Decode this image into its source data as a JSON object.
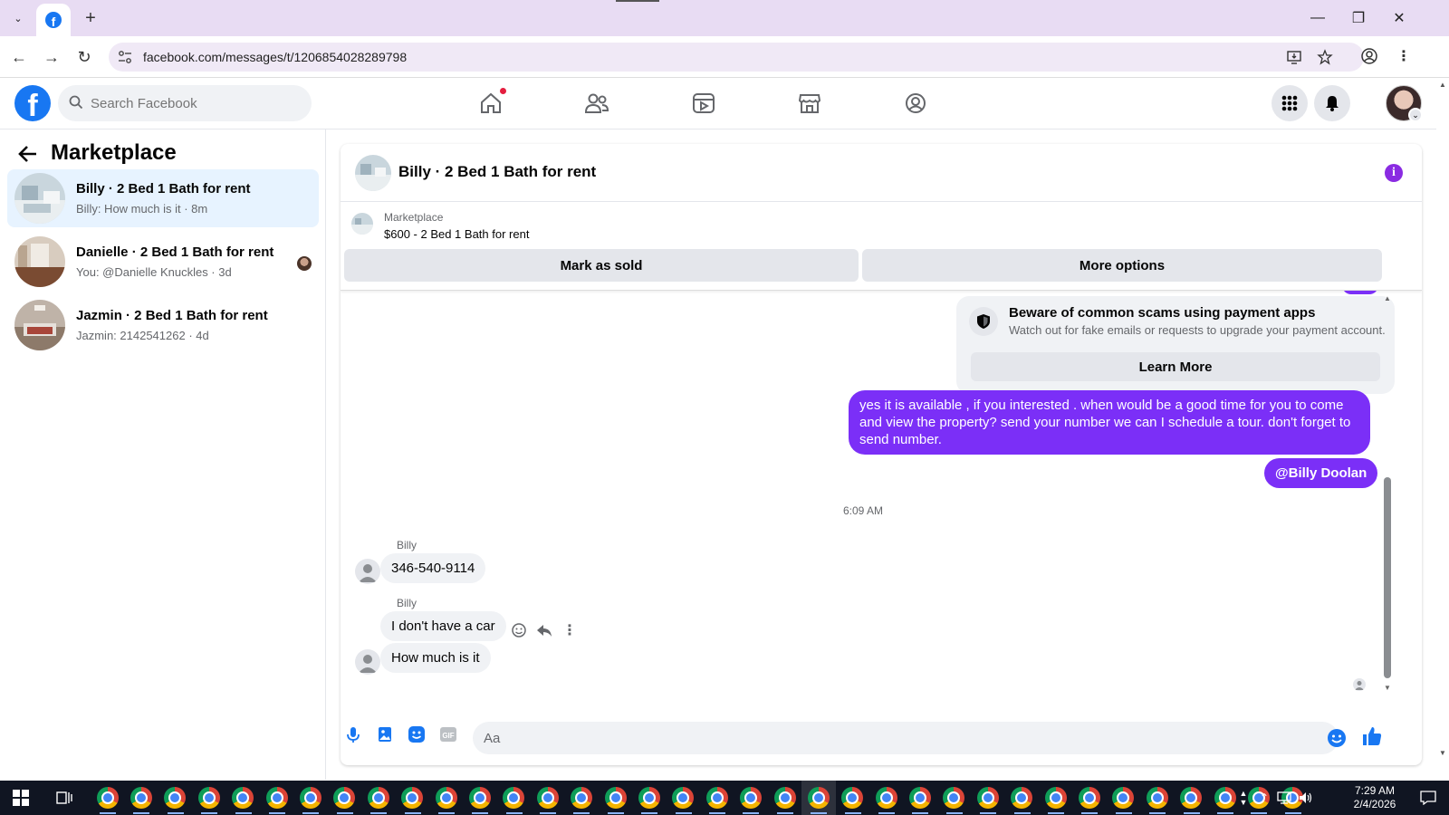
{
  "browser": {
    "url": "facebook.com/messages/t/1206854028289798"
  },
  "fb_header": {
    "search_placeholder": "Search Facebook"
  },
  "sidebar": {
    "title": "Marketplace",
    "conversations": [
      {
        "name": "Billy · 2 Bed 1 Bath for rent",
        "preview": "Billy: How much is it · 8m",
        "active": true
      },
      {
        "name": "Danielle · 2 Bed 1 Bath for rent",
        "preview": "You: @Danielle Knuckles · 3d",
        "active": false
      },
      {
        "name": "Jazmin · 2 Bed 1 Bath for rent",
        "preview": "Jazmin: 2142541262 · 4d",
        "active": false
      }
    ]
  },
  "chat": {
    "title": "Billy · 2 Bed 1 Bath for rent",
    "marketplace_label": "Marketplace",
    "listing": "$600 - 2 Bed 1 Bath for rent",
    "mark_sold_label": "Mark as sold",
    "more_options_label": "More options",
    "scam_title": "Beware of common scams using payment apps",
    "scam_sub": "Watch out for fake emails or requests to upgrade your payment account.",
    "learn_more_label": "Learn More",
    "outgoing_message": "yes it is available , if you interested . when would be  a good time for you to come and view the  property? send your number we can I schedule  a tour. don't forget to send  number.",
    "mention": "@Billy Doolan",
    "timestamp": "6:09 AM",
    "incoming": [
      {
        "sender": "Billy",
        "text": "346-540-9114"
      },
      {
        "sender": "Billy",
        "text": "I don't have a car"
      },
      {
        "sender": "",
        "text": "How much is it"
      }
    ],
    "composer_placeholder": "Aa"
  },
  "taskbar": {
    "time": "7:29 AM",
    "date": "2/4/2026"
  },
  "colors": {
    "accent": "#7b2ff7",
    "fb_blue": "#1877f2",
    "active_conv": "#e7f3ff"
  }
}
